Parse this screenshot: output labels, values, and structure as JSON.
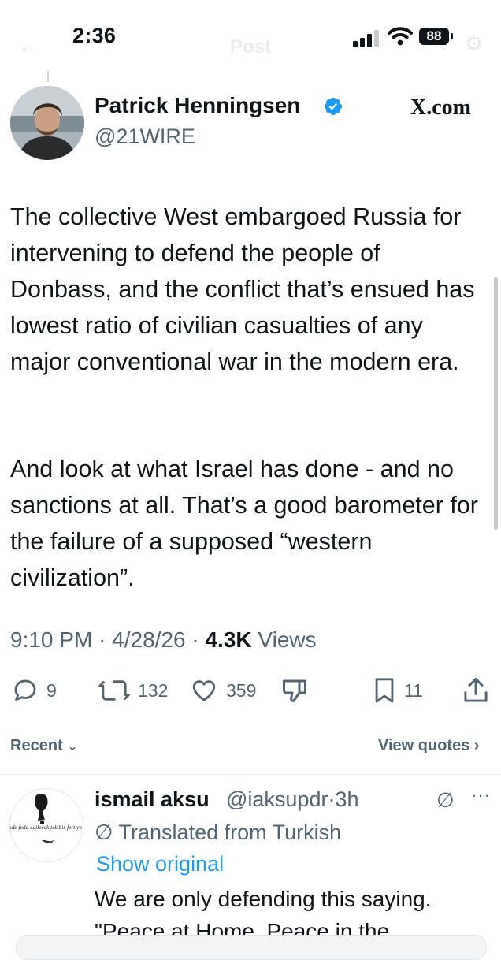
{
  "status_bar": {
    "time": "2:36",
    "battery": "88"
  },
  "nav": {
    "back_icon": "back-arrow-icon",
    "title": "Post"
  },
  "author": {
    "name": "Patrick Henningsen",
    "handle": "@21WIRE",
    "verified": true,
    "source": "X.com"
  },
  "tweet": {
    "paragraphs": [
      "The collective West embargoed Russia for intervening to defend the people of Donbass, and the conflict that’s ensued has lowest ratio of civilian casualties of any major conventional war in the modern era.",
      "And look at what Israel has done - and no sanctions at all. That’s a good barometer for the failure of a supposed “western civilization”."
    ],
    "time": "9:10 PM",
    "date": "4/28/26",
    "views_count": "4.3K",
    "views_label": "Views",
    "separator": "·"
  },
  "actions": {
    "replies": "9",
    "reposts": "132",
    "likes": "359",
    "bookmarks": "11"
  },
  "replies_header": {
    "sort_label": "Recent",
    "view_quotes_label": "View quotes"
  },
  "reply": {
    "name": "ismail aksu",
    "handle": "@iaksupdr",
    "time": "3h",
    "separator": "·",
    "translated_label": "Translated from Turkish",
    "show_original_label": "Show original",
    "text_line1": "We are only defending this saying.",
    "text_line2": "\"Peace at Home, Peace in the",
    "avatar_caption": "nde feda edilecek tek bir fert yo"
  },
  "colors": {
    "accent": "#1d9bf0",
    "text": "#0f1419",
    "muted": "#536471"
  }
}
